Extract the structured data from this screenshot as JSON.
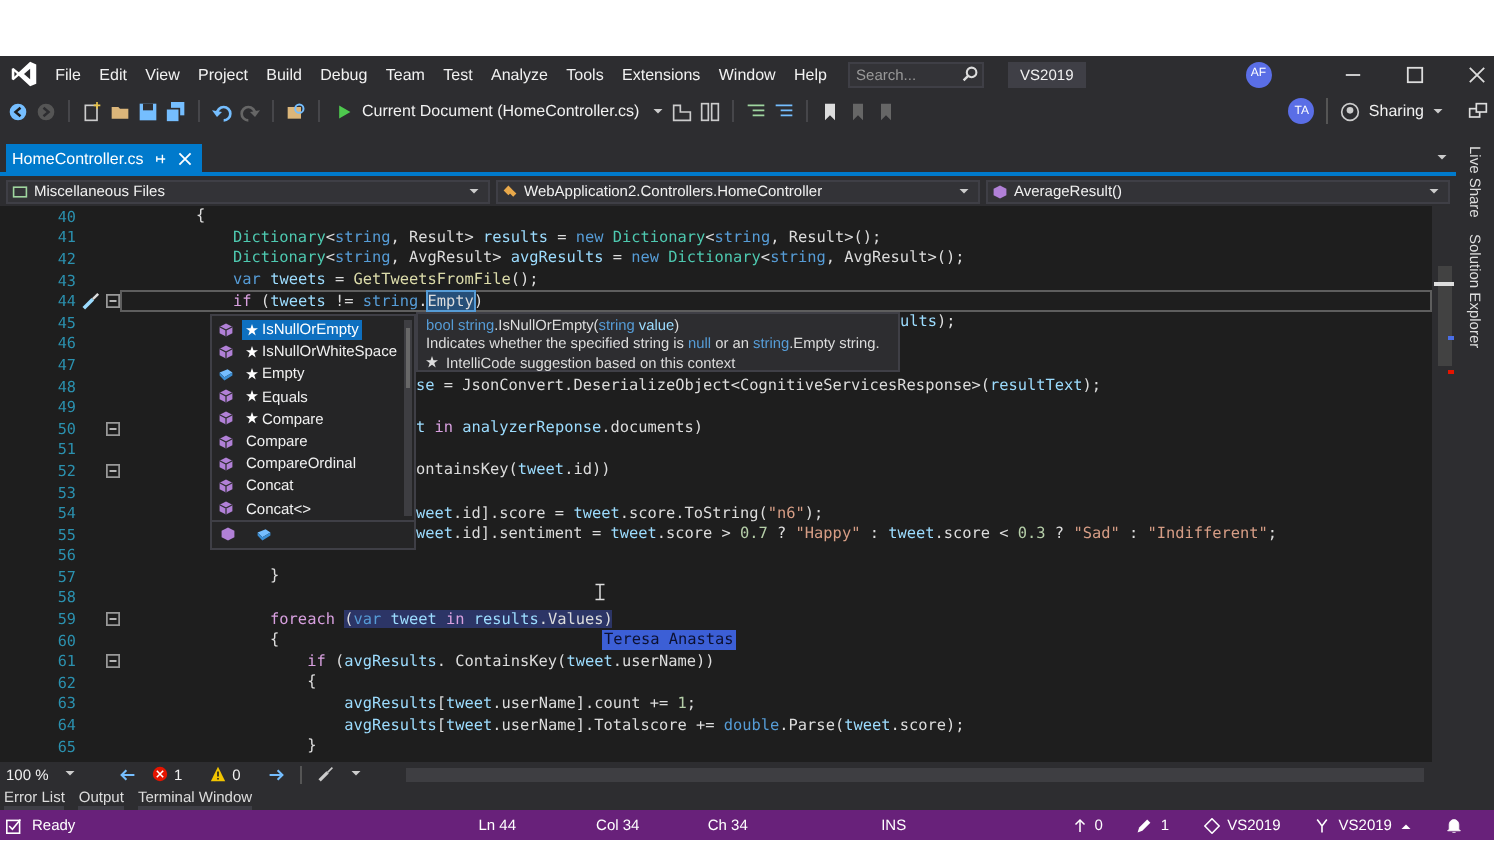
{
  "menu": {
    "items": [
      "File",
      "Edit",
      "View",
      "Project",
      "Build",
      "Debug",
      "Team",
      "Test",
      "Analyze",
      "Tools",
      "Extensions",
      "Window",
      "Help"
    ],
    "search": {
      "placeholder": "Search..."
    },
    "badge": "VS2019",
    "avatar": "AF"
  },
  "toolbar": {
    "run_target": "Current Document (HomeController.cs)",
    "avatar": "TA",
    "share": "Sharing"
  },
  "tabs": [
    {
      "label": "HomeController.cs",
      "selected": true
    }
  ],
  "navbar": [
    {
      "label": "Miscellaneous Files",
      "kind": "project"
    },
    {
      "label": "WebApplication2.Controllers.HomeController",
      "kind": "class"
    },
    {
      "label": "AverageResult()",
      "kind": "member"
    }
  ],
  "side_panels": [
    "Live Share",
    "Solution Explorer"
  ],
  "editor": {
    "lines": [
      {
        "num": "40",
        "kind": "code",
        "fold": false,
        "current": false,
        "tokens": [
          {
            "t": "        {",
            "kind": "plain"
          }
        ]
      },
      {
        "num": "41",
        "kind": "code",
        "fold": false,
        "current": false,
        "tokens": [
          {
            "t": "            Dictionary",
            "kind": "type"
          },
          {
            "t": "<",
            "kind": "plain"
          },
          {
            "t": "string",
            "kind": "kw"
          },
          {
            "t": ", Result> ",
            "kind": "plain"
          },
          {
            "t": "results",
            "kind": "var"
          },
          {
            "t": " = ",
            "kind": "plain"
          },
          {
            "t": "new ",
            "kind": "kw"
          },
          {
            "t": "Dictionary",
            "kind": "type"
          },
          {
            "t": "<",
            "kind": "plain"
          },
          {
            "t": "string",
            "kind": "kw"
          },
          {
            "t": ", Result>();",
            "kind": "plain"
          }
        ]
      },
      {
        "num": "42",
        "kind": "code",
        "fold": false,
        "current": false,
        "tokens": [
          {
            "t": "            Dictionary",
            "kind": "type"
          },
          {
            "t": "<",
            "kind": "plain"
          },
          {
            "t": "string",
            "kind": "kw"
          },
          {
            "t": ", AvgResult> ",
            "kind": "plain"
          },
          {
            "t": "avgResults",
            "kind": "var"
          },
          {
            "t": " = ",
            "kind": "plain"
          },
          {
            "t": "new ",
            "kind": "kw"
          },
          {
            "t": "Dictionary",
            "kind": "type"
          },
          {
            "t": "<",
            "kind": "plain"
          },
          {
            "t": "string",
            "kind": "kw"
          },
          {
            "t": ", AvgResult>();",
            "kind": "plain"
          }
        ]
      },
      {
        "num": "43",
        "kind": "code",
        "fold": false,
        "current": false,
        "tokens": [
          {
            "t": "            var ",
            "kind": "kw"
          },
          {
            "t": "tweets",
            "kind": "var"
          },
          {
            "t": " = ",
            "kind": "plain"
          },
          {
            "t": "GetTweetsFromFile",
            "kind": "method"
          },
          {
            "t": "();",
            "kind": "plain"
          }
        ]
      },
      {
        "num": "44",
        "kind": "code",
        "fold": true,
        "current": true,
        "tokens": [
          {
            "t": "            if",
            "kind": "ctl"
          },
          {
            "t": " (",
            "kind": "plain"
          },
          {
            "t": "tweets",
            "kind": "var"
          },
          {
            "t": " != ",
            "kind": "plain"
          },
          {
            "t": "string",
            "kind": "kw"
          },
          {
            "t": ".",
            "kind": "plain"
          },
          {
            "t": "Empty",
            "kind": "plain",
            "selected": true
          },
          {
            "t": ")",
            "kind": "plain"
          }
        ]
      },
      {
        "num": "45",
        "kind": "after_tip",
        "fold": false,
        "current": false,
        "tokens": [
          {
            "t": "ults",
            "kind": "var"
          },
          {
            "t": ");",
            "kind": "plain"
          }
        ]
      },
      {
        "num": "46",
        "kind": "code",
        "fold": false,
        "current": false
      },
      {
        "num": "47",
        "kind": "code",
        "fold": false,
        "current": false
      },
      {
        "num": "48",
        "kind": "after_list",
        "fold": false,
        "current": false,
        "tokens": [
          {
            "t": "se",
            "kind": "var"
          },
          {
            "t": " = JsonConvert.DeserializeObject<CognitiveServicesResponse>(",
            "kind": "plain"
          },
          {
            "t": "resultText",
            "kind": "var"
          },
          {
            "t": ");",
            "kind": "plain"
          }
        ]
      },
      {
        "num": "49",
        "kind": "code",
        "fold": false,
        "current": false
      },
      {
        "num": "50",
        "kind": "after_list",
        "fold": true,
        "current": false,
        "tokens": [
          {
            "t": "t ",
            "kind": "var"
          },
          {
            "t": "in ",
            "kind": "ctl"
          },
          {
            "t": "analyzerReponse",
            "kind": "var"
          },
          {
            "t": ".documents)",
            "kind": "plain"
          }
        ]
      },
      {
        "num": "51",
        "kind": "code",
        "fold": false,
        "current": false
      },
      {
        "num": "52",
        "kind": "after_list",
        "fold": true,
        "current": false,
        "tokens": [
          {
            "t": "ontainsKey(",
            "kind": "plain"
          },
          {
            "t": "tweet",
            "kind": "var"
          },
          {
            "t": ".id))",
            "kind": "plain"
          }
        ]
      },
      {
        "num": "53",
        "kind": "code",
        "fold": false,
        "current": false
      },
      {
        "num": "54",
        "kind": "after_list",
        "fold": false,
        "current": false,
        "tokens": [
          {
            "t": "weet",
            "kind": "var"
          },
          {
            "t": ".id].score = ",
            "kind": "plain"
          },
          {
            "t": "tweet",
            "kind": "var"
          },
          {
            "t": ".score.ToString(",
            "kind": "plain"
          },
          {
            "t": "\"n6\"",
            "kind": "str"
          },
          {
            "t": ");",
            "kind": "plain"
          }
        ]
      },
      {
        "num": "55",
        "kind": "after_list",
        "fold": false,
        "current": false,
        "tokens": [
          {
            "t": "weet",
            "kind": "var"
          },
          {
            "t": ".id].sentiment = ",
            "kind": "plain"
          },
          {
            "t": "tweet",
            "kind": "var"
          },
          {
            "t": ".score > ",
            "kind": "plain"
          },
          {
            "t": "0.7",
            "kind": "num"
          },
          {
            "t": " ? ",
            "kind": "plain"
          },
          {
            "t": "\"Happy\"",
            "kind": "str"
          },
          {
            "t": " : ",
            "kind": "plain"
          },
          {
            "t": "tweet",
            "kind": "var"
          },
          {
            "t": ".score < ",
            "kind": "plain"
          },
          {
            "t": "0.3",
            "kind": "num"
          },
          {
            "t": " ? ",
            "kind": "plain"
          },
          {
            "t": "\"Sad\"",
            "kind": "str"
          },
          {
            "t": " : ",
            "kind": "plain"
          },
          {
            "t": "\"Indifferent\"",
            "kind": "str"
          },
          {
            "t": ";",
            "kind": "plain"
          }
        ]
      },
      {
        "num": "56",
        "kind": "code",
        "fold": false,
        "current": false
      },
      {
        "num": "57",
        "kind": "code",
        "fold": false,
        "current": false,
        "tokens": [
          {
            "t": "                }",
            "kind": "plain"
          }
        ]
      },
      {
        "num": "58",
        "kind": "code",
        "fold": false,
        "current": false
      },
      {
        "num": "59",
        "kind": "code",
        "fold": true,
        "current": false,
        "peer_label": "Teresa Anastas",
        "tokens": [
          {
            "t": "                foreach ",
            "kind": "ctl"
          },
          {
            "t": "(",
            "kind": "plain",
            "peer_selected": true
          },
          {
            "t": "var ",
            "kind": "kw",
            "peer_selected": true
          },
          {
            "t": "tweet ",
            "kind": "var",
            "peer_selected": true
          },
          {
            "t": "in ",
            "kind": "ctl",
            "peer_selected": true
          },
          {
            "t": "results",
            "kind": "var",
            "peer_selected": true
          },
          {
            "t": ".Values)",
            "kind": "plain",
            "peer_selected": true
          }
        ]
      },
      {
        "num": "60",
        "kind": "code",
        "fold": false,
        "current": false,
        "tokens": [
          {
            "t": "                {",
            "kind": "plain"
          }
        ]
      },
      {
        "num": "61",
        "kind": "code",
        "fold": true,
        "current": false,
        "tokens": [
          {
            "t": "                    if",
            "kind": "ctl"
          },
          {
            "t": " (",
            "kind": "plain"
          },
          {
            "t": "avgResults",
            "kind": "var"
          },
          {
            "t": ". ContainsKey(",
            "kind": "plain"
          },
          {
            "t": "tweet",
            "kind": "var"
          },
          {
            "t": ".userName))",
            "kind": "plain"
          }
        ]
      },
      {
        "num": "62",
        "kind": "code",
        "fold": false,
        "current": false,
        "tokens": [
          {
            "t": "                    {",
            "kind": "plain"
          }
        ]
      },
      {
        "num": "63",
        "kind": "code",
        "fold": false,
        "current": false,
        "tokens": [
          {
            "t": "                        avgResults",
            "kind": "var"
          },
          {
            "t": "[",
            "kind": "plain"
          },
          {
            "t": "tweet",
            "kind": "var"
          },
          {
            "t": ".userName].count += ",
            "kind": "plain"
          },
          {
            "t": "1",
            "kind": "num"
          },
          {
            "t": ";",
            "kind": "plain"
          }
        ]
      },
      {
        "num": "64",
        "kind": "code",
        "fold": false,
        "current": false,
        "tokens": [
          {
            "t": "                        avgResults",
            "kind": "var"
          },
          {
            "t": "[",
            "kind": "plain"
          },
          {
            "t": "tweet",
            "kind": "var"
          },
          {
            "t": ".userName].Totalscore += ",
            "kind": "plain"
          },
          {
            "t": "double",
            "kind": "kw"
          },
          {
            "t": ".Parse(",
            "kind": "plain"
          },
          {
            "t": "tweet",
            "kind": "var"
          },
          {
            "t": ".score);",
            "kind": "plain"
          }
        ]
      },
      {
        "num": "65",
        "kind": "code",
        "fold": false,
        "current": false,
        "tokens": [
          {
            "t": "                    }",
            "kind": "plain"
          }
        ]
      }
    ],
    "completion": {
      "items": [
        {
          "label": "IsNullOrEmpty",
          "kind": "method",
          "starred": true,
          "selected": true
        },
        {
          "label": "IsNullOrWhiteSpace",
          "kind": "method",
          "starred": true,
          "selected": false
        },
        {
          "label": "Empty",
          "kind": "field",
          "starred": true,
          "selected": false
        },
        {
          "label": "Equals",
          "kind": "method",
          "starred": true,
          "selected": false
        },
        {
          "label": "Compare",
          "kind": "method",
          "starred": true,
          "selected": false
        },
        {
          "label": "Compare",
          "kind": "method",
          "starred": false,
          "selected": false
        },
        {
          "label": "CompareOrdinal",
          "kind": "method",
          "starred": false,
          "selected": false
        },
        {
          "label": "Concat",
          "kind": "method",
          "starred": false,
          "selected": false
        },
        {
          "label": "Concat<>",
          "kind": "method",
          "starred": false,
          "selected": false
        }
      ],
      "tooltip": {
        "signature": [
          {
            "t": "bool string",
            "kind": "kw"
          },
          {
            "t": ".IsNullOrEmpty(",
            "kind": "plain"
          },
          {
            "t": "string",
            "kind": "kw"
          },
          {
            "t": " value",
            "kind": "var"
          },
          {
            "t": ")",
            "kind": "plain"
          }
        ],
        "description": [
          {
            "t": "Indicates whether the specified string is ",
            "kind": "plain"
          },
          {
            "t": "null",
            "kind": "kw"
          },
          {
            "t": " or an ",
            "kind": "plain"
          },
          {
            "t": "string",
            "kind": "kw"
          },
          {
            "t": ".Empty string.",
            "kind": "plain"
          }
        ],
        "note": "IntelliCode suggestion based on this context"
      }
    }
  },
  "editor_bar": {
    "zoom": "100 %",
    "errors": "1",
    "warnings": "0"
  },
  "tool_tabs": [
    "Error List",
    "Output",
    "Terminal Window"
  ],
  "status": {
    "message": "Ready",
    "ln": "Ln 44",
    "col": "Col 34",
    "ch": "Ch 34",
    "mode": "INS",
    "pushes": "0",
    "edits": "1",
    "repo": "VS2019",
    "branch": "VS2019"
  }
}
